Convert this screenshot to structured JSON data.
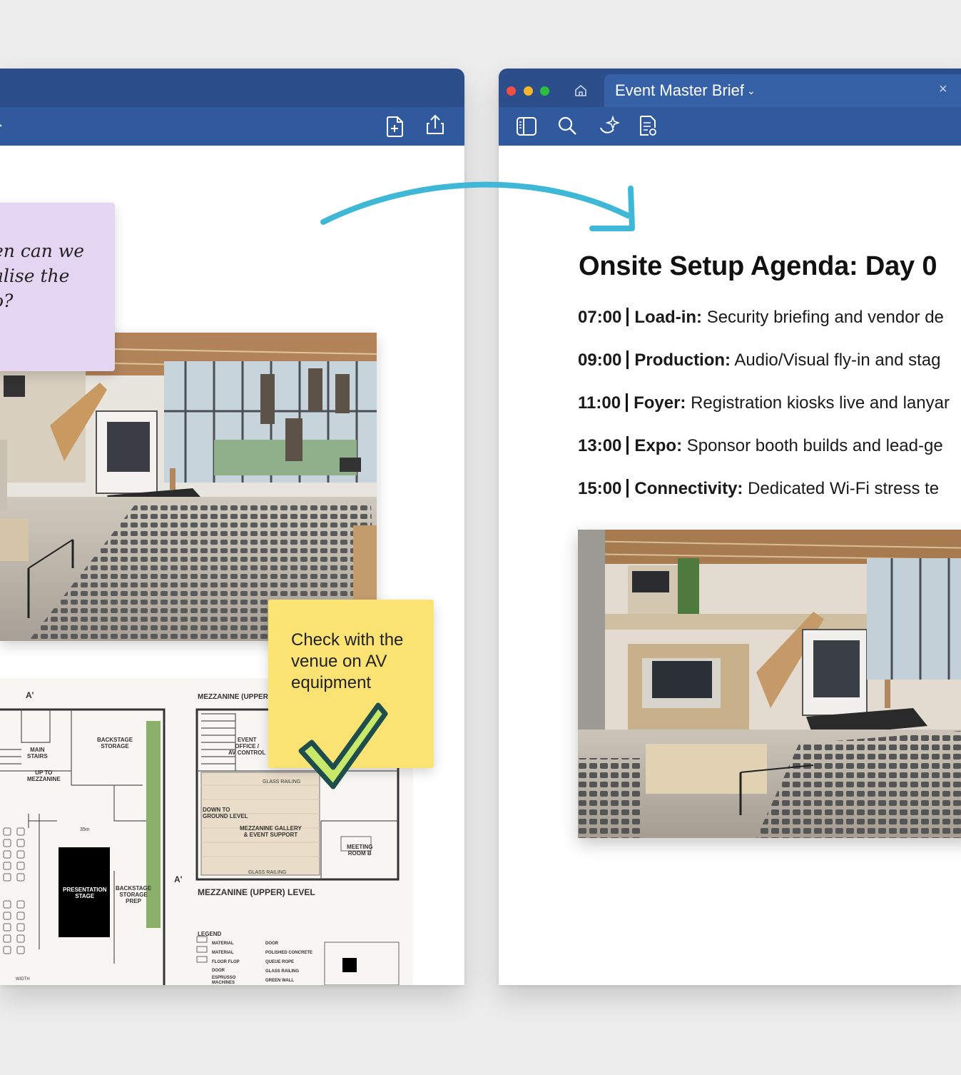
{
  "right_window": {
    "tab_title": "Event Master Brief",
    "tab_chevron": "⌄",
    "close_symbol": "×"
  },
  "left_window": {
    "sticky_note_purple": "en can we\nalise the\no?",
    "sticky_note_yellow": "Check with the venue on AV equipment"
  },
  "document": {
    "title": "Onsite Setup Agenda: Day 0",
    "agenda": [
      {
        "time": "07:00",
        "label": "Load-in:",
        "text": "Security briefing and vendor de"
      },
      {
        "time": "09:00",
        "label": "Production:",
        "text": "Audio/Visual fly-in and stag"
      },
      {
        "time": "11:00",
        "label": "Foyer:",
        "text": "Registration kiosks live and lanyar"
      },
      {
        "time": "13:00",
        "label": "Expo:",
        "text": "Sponsor booth builds and lead-ge"
      },
      {
        "time": "15:00",
        "label": "Connectivity:",
        "text": "Dedicated Wi-Fi stress te"
      }
    ]
  },
  "floorplan": {
    "labels": {
      "section_a": "A'",
      "mezz_header": "MEZZANINE (UPPER",
      "backstage_storage": "BACKSTAGE\nSTORAGE",
      "main_stairs": "MAIN\nSTAIRS",
      "up_to_mezz": "UP TO\nMEZZANINE",
      "event_office": "EVENT\nOFFICE /\nAV CONTROL",
      "glass_railing_top": "GLASS RAILING",
      "down_to_ground": "DOWN TO\nGROUND LEVEL",
      "mezz_gallery": "MEZZANINE GALLERY\n& EVENT SUPPORT",
      "meeting_room": "MEETING\nROOM B",
      "glass_railing_bottom": "GLASS RAILING",
      "dimension": "35m",
      "presentation_stage": "PRESENTATION\nSTAGE",
      "backstage_prep": "BACKSTAGE\nSTORAGE\nPREP",
      "section_a2": "A'",
      "mezz_level": "MEZZANINE (UPPER) LEVEL",
      "legend": "LEGEND",
      "width_label": "WIDTH"
    },
    "legend_items_left": [
      "MATERIAL",
      "MATERIAL",
      "FLOOR FLOP",
      "DOOR",
      "ESPRUSSO\nMACHINES"
    ],
    "legend_items_right": [
      "DOOR",
      "POLISHED CONCRETE",
      "QUEUE ROPE",
      "GLASS RAILING",
      "GREEN WALL"
    ]
  },
  "colors": {
    "titlebar": "#2c4f8c",
    "toolbar": "#315a9e",
    "arrow": "#3fb8d8",
    "sticky_purple": "#e4d5f3",
    "sticky_yellow": "#fbe373",
    "check": "#c8e86a"
  },
  "icons": {
    "left_toolbar": [
      "add-page-icon",
      "share-icon"
    ],
    "right_toolbar": [
      "sidebar-icon",
      "search-icon",
      "ai-sparkle-icon",
      "page-settings-icon"
    ],
    "tab": [
      "home-icon",
      "close-icon"
    ]
  }
}
